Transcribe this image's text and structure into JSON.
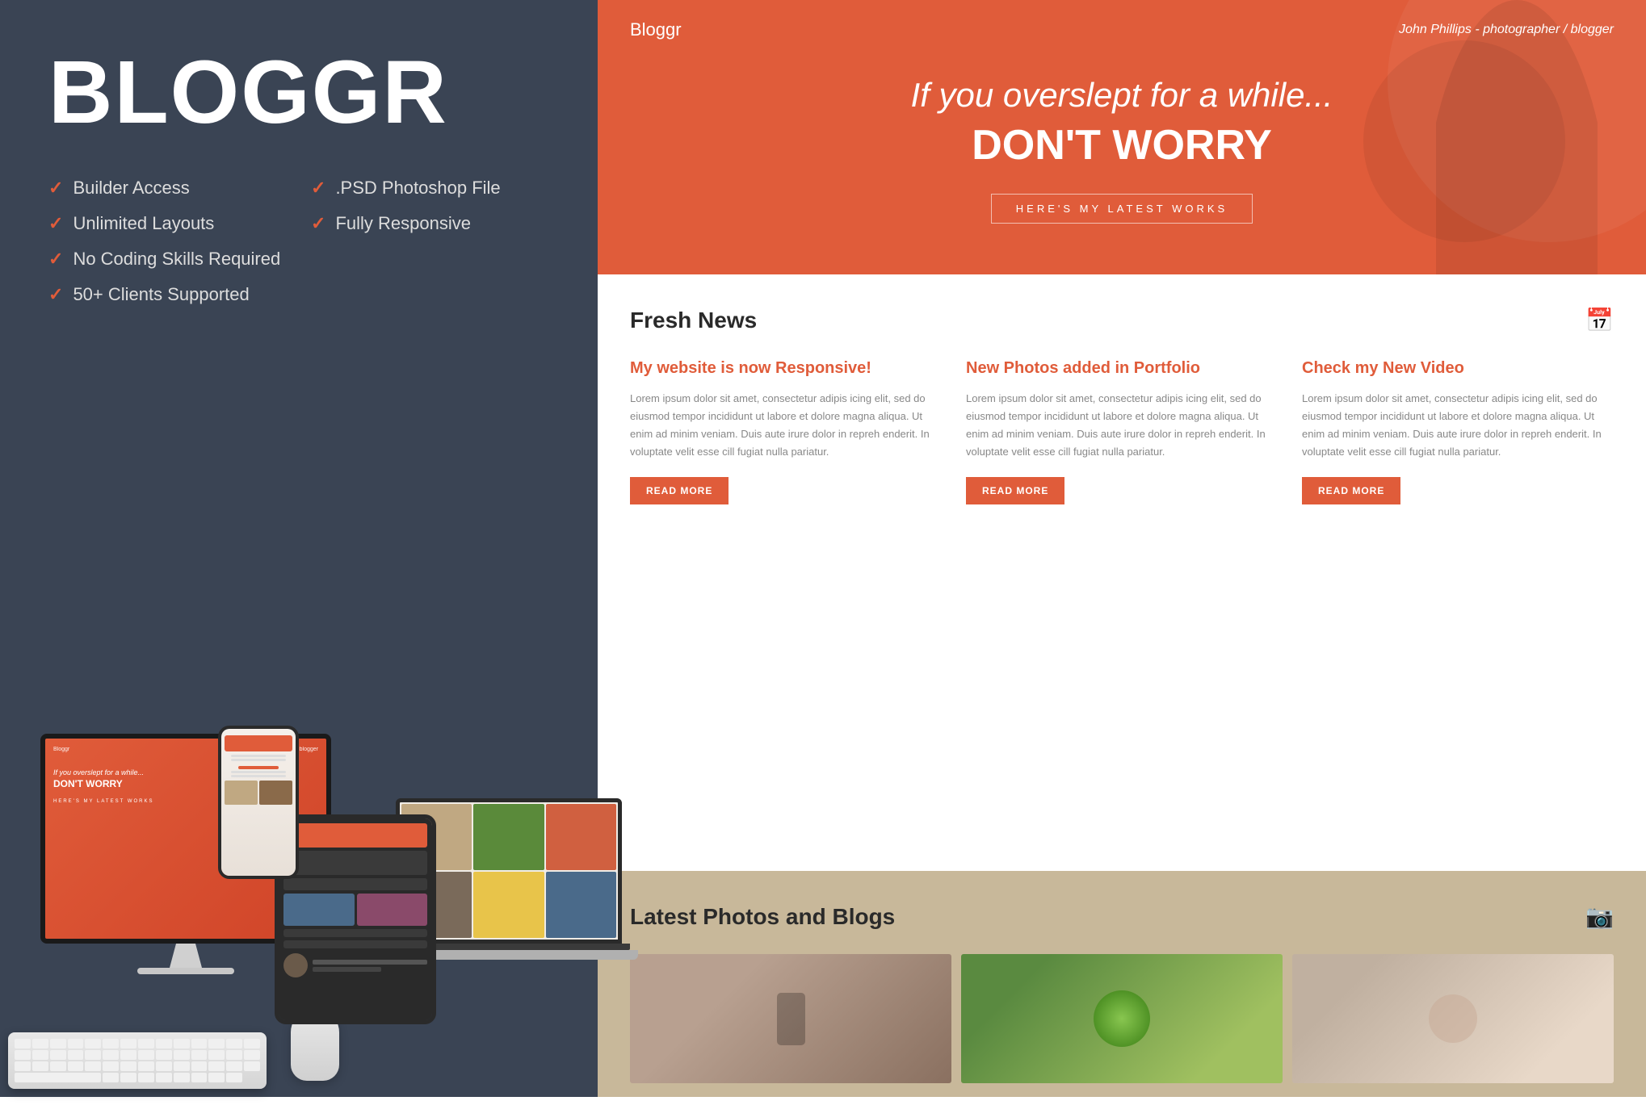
{
  "left": {
    "brand": "BLOGGR",
    "features_col1": [
      "Builder Access",
      "Unlimited Layouts",
      "No Coding Skills Required",
      "50+ Clients Supported"
    ],
    "features_col2": [
      ".PSD Photoshop File",
      "Fully Responsive"
    ]
  },
  "hero": {
    "logo": "Bloggr",
    "author": "John Phillips - photographer / blogger",
    "subtitle": "If you overslept for a while...",
    "main_title": "DON'T WORRY",
    "cta": "HERE'S MY LATEST WORKS"
  },
  "fresh_news": {
    "section_title": "Fresh News",
    "articles": [
      {
        "title": "My website is now Responsive!",
        "body": "Lorem ipsum dolor sit amet, consectetur adipis icing elit, sed do eiusmod tempor incididunt ut labore et dolore magna aliqua. Ut enim ad minim veniam. Duis aute irure dolor in repreh enderit. In voluptate velit esse cill fugiat nulla pariatur.",
        "cta": "READ MORE"
      },
      {
        "title": "New Photos added in Portfolio",
        "body": "Lorem ipsum dolor sit amet, consectetur adipis icing elit, sed do eiusmod tempor incididunt ut labore et dolore magna aliqua. Ut enim ad minim veniam. Duis aute irure dolor in repreh enderit. In voluptate velit esse cill fugiat nulla pariatur.",
        "cta": "READ MORE"
      },
      {
        "title": "Check my New Video",
        "body": "Lorem ipsum dolor sit amet, consectetur adipis icing elit, sed do eiusmod tempor incididunt ut labore et dolore magna aliqua. Ut enim ad minim veniam. Duis aute irure dolor in repreh enderit. In voluptate velit esse cill fugiat nulla pariatur.",
        "cta": "READ MORE"
      }
    ]
  },
  "latest_photos": {
    "section_title": "Latest Photos and Blogs"
  },
  "colors": {
    "accent": "#e05c3a",
    "dark_bg": "#3a4454",
    "tan_bg": "#c8b89a",
    "text_dark": "#2a2a2a",
    "text_muted": "#888888"
  }
}
